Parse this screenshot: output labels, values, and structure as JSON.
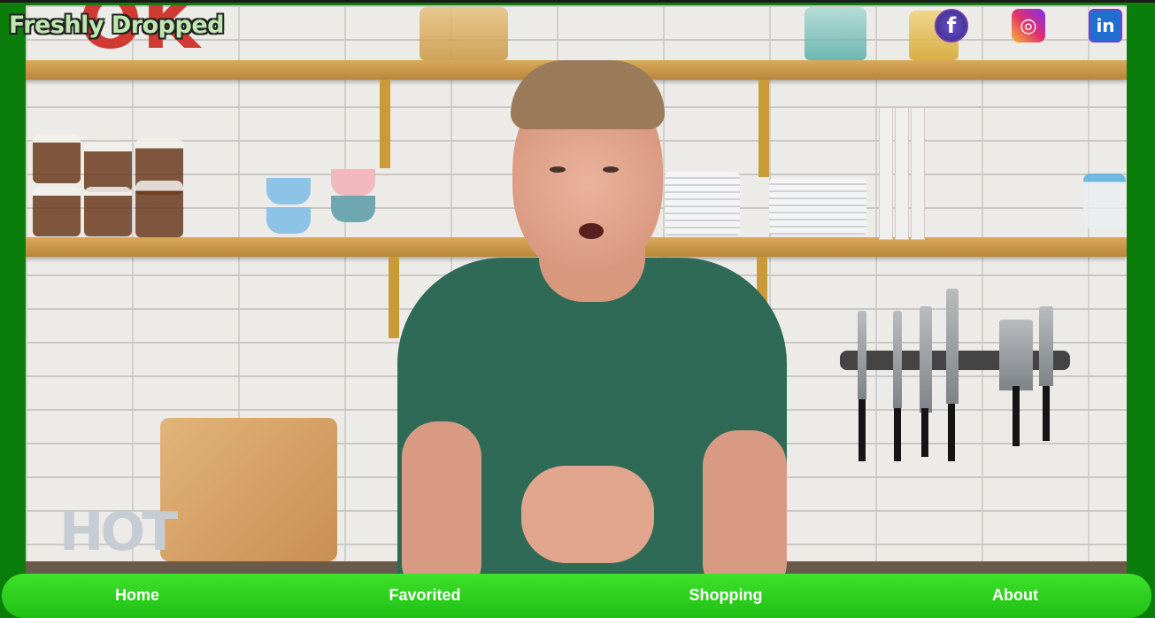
{
  "brand": {
    "title": "Freshly Dropped"
  },
  "social": {
    "facebook_icon": "facebook-icon",
    "facebook_glyph": "f",
    "instagram_icon": "instagram-icon",
    "instagram_glyph": "◎",
    "linkedin_icon": "linkedin-icon",
    "linkedin_glyph": "in"
  },
  "hero": {
    "background_sign": "OK",
    "counter_sign": "HOT"
  },
  "nav": {
    "items": [
      {
        "label": "Home"
      },
      {
        "label": "Favorited"
      },
      {
        "label": "Shopping"
      },
      {
        "label": "About"
      }
    ]
  },
  "colors": {
    "frame_green": "#0b7d0b",
    "nav_green": "#2fd11f",
    "nav_text": "#ffffff",
    "shirt": "#2f6a57"
  }
}
